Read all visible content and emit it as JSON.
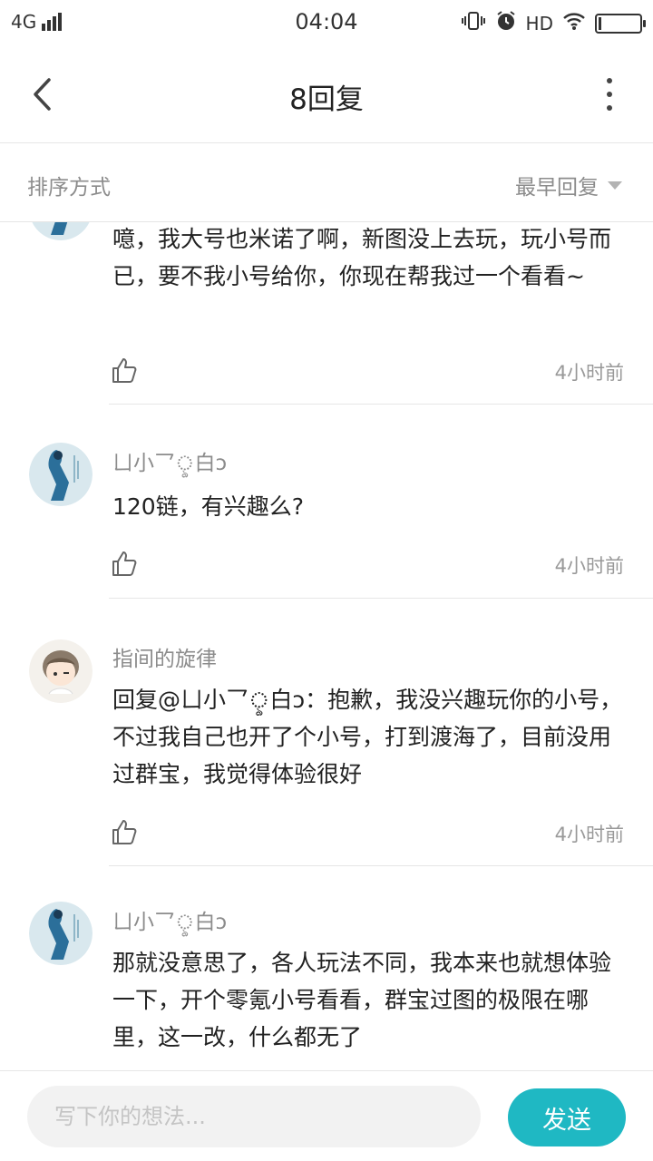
{
  "status_bar": {
    "network": "4G",
    "time": "04:04",
    "hd": "HD"
  },
  "nav": {
    "title": "8回复"
  },
  "sort": {
    "label": "排序方式",
    "selected": "最早回复"
  },
  "replies": [
    {
      "name": "",
      "text": "噫，我大号也米诺了啊，新图没上去玩，玩小号而已，要不我小号给你，你现在帮我过一个看看~",
      "time": "4小时前"
    },
    {
      "name": "ㄩ小⺂ৢ白ↄ",
      "text": "120链，有兴趣么?",
      "time": "4小时前"
    },
    {
      "name": "指间的旋律",
      "text": "回复@ㄩ小⺂ৢ白ↄ：抱歉，我没兴趣玩你的小号，不过我自己也开了个小号，打到渡海了，目前没用过群宝，我觉得体验很好",
      "time": "4小时前"
    },
    {
      "name": "ㄩ小⺂ৢ白ↄ",
      "text": "那就没意思了，各人玩法不同，我本来也就想体验一下，开个零氪小号看看，群宝过图的极限在哪里，这一改，什么都无了",
      "time": ""
    }
  ],
  "composer": {
    "placeholder": "写下你的想法...",
    "send_label": "发送"
  }
}
